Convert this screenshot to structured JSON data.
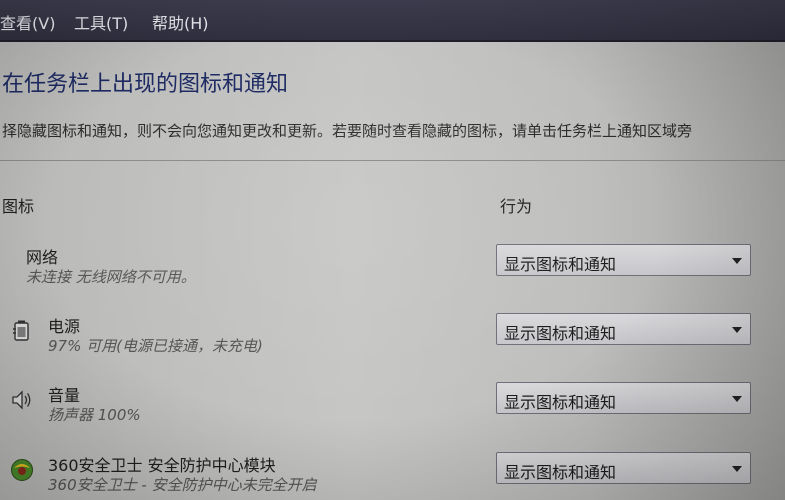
{
  "menu": {
    "view": "查看(V)",
    "tools": "工具(T)",
    "help": "帮助(H)"
  },
  "page": {
    "title": "在任务栏上出现的图标和通知",
    "description": "择隐藏图标和通知，则不会向您通知更改和更新。若要随时查看隐藏的图标，请单击任务栏上通知区域旁"
  },
  "table": {
    "col_icons": "图标",
    "col_behavior": "行为",
    "rows": [
      {
        "name": "网络",
        "status": "未连接 无线网络不可用。",
        "icon": "network-icon",
        "behavior": "显示图标和通知"
      },
      {
        "name": "电源",
        "status": "97% 可用(电源已接通，未充电)",
        "icon": "power-icon",
        "behavior": "显示图标和通知"
      },
      {
        "name": "音量",
        "status": "扬声器 100%",
        "icon": "speaker-icon",
        "behavior": "显示图标和通知"
      },
      {
        "name": "360安全卫士 安全防护中心模块",
        "status": "360安全卫士 - 安全防护中心未完全开启",
        "icon": "360-shield-icon",
        "behavior": "显示图标和通知"
      }
    ]
  },
  "colors": {
    "title": "#1d2a63",
    "menubar": "#2f2f3f",
    "background": "#c0c0be"
  }
}
